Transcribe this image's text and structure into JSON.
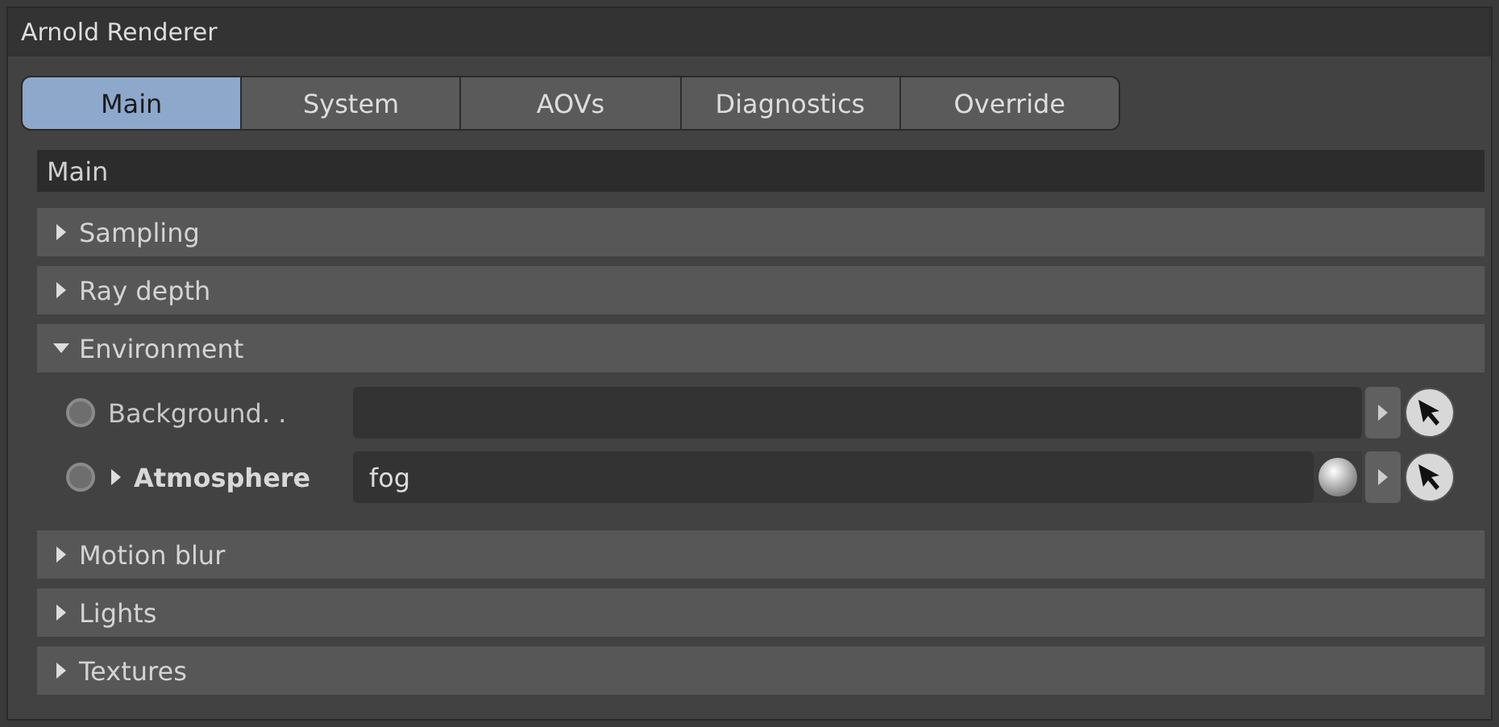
{
  "window": {
    "title": "Arnold Renderer"
  },
  "tabs": [
    {
      "label": "Main",
      "selected": true
    },
    {
      "label": "System",
      "selected": false
    },
    {
      "label": "AOVs",
      "selected": false
    },
    {
      "label": "Diagnostics",
      "selected": false
    },
    {
      "label": "Override",
      "selected": false
    }
  ],
  "section": {
    "title": "Main"
  },
  "groups": [
    {
      "label": "Sampling",
      "expanded": false
    },
    {
      "label": "Ray depth",
      "expanded": false
    },
    {
      "label": "Environment",
      "expanded": true,
      "params": [
        {
          "label": "Background. .",
          "kind": "link",
          "bold": false,
          "expandable": false
        },
        {
          "label": "Atmosphere",
          "kind": "shader",
          "bold": true,
          "expandable": true,
          "value": "fog"
        }
      ]
    },
    {
      "label": "Motion blur",
      "expanded": false
    },
    {
      "label": "Lights",
      "expanded": false
    },
    {
      "label": "Textures",
      "expanded": false
    }
  ]
}
